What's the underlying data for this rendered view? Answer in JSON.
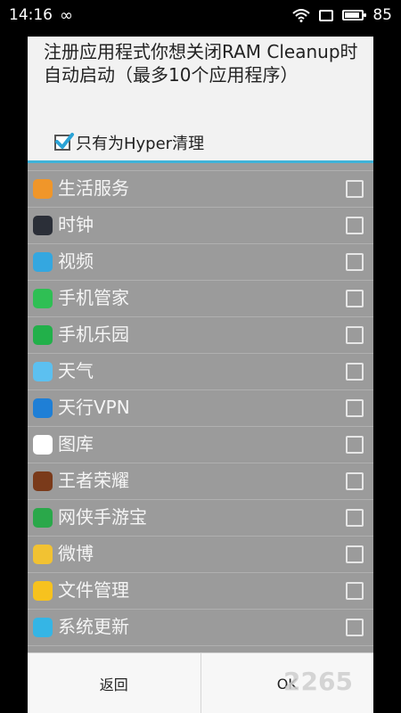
{
  "status_bar": {
    "time": "14:16",
    "battery": "85"
  },
  "dialog": {
    "title": "注册应用程式你想关闭RAM Cleanup时自动启动（最多10个应用程序）",
    "hyper_only_label": "只有为Hyper清理",
    "hyper_only_checked": true
  },
  "apps": [
    {
      "label": "",
      "icon": "partial-icon",
      "color": "#7c7c7c"
    },
    {
      "label": "生活服务",
      "icon": "coffee-cup-icon",
      "color": "#f0962a"
    },
    {
      "label": "时钟",
      "icon": "clock-icon",
      "color": "#2b2f38"
    },
    {
      "label": "视频",
      "icon": "video-clapper-icon",
      "color": "#34a7e0"
    },
    {
      "label": "手机管家",
      "icon": "shield-plus-icon",
      "color": "#2fbf54"
    },
    {
      "label": "手机乐园",
      "icon": "s-store-icon",
      "color": "#22b04a"
    },
    {
      "label": "天气",
      "icon": "cloud-sun-icon",
      "color": "#5cc0f0"
    },
    {
      "label": "天行VPN",
      "icon": "globe-icon",
      "color": "#1f7fd6"
    },
    {
      "label": "图库",
      "icon": "flower-icon",
      "color": "#ffffff"
    },
    {
      "label": "王者荣耀",
      "icon": "hero-game-icon",
      "color": "#7a3a1a"
    },
    {
      "label": "网侠手游宝",
      "icon": "recycle-icon",
      "color": "#2aa84a"
    },
    {
      "label": "微博",
      "icon": "weibo-icon",
      "color": "#f2c232"
    },
    {
      "label": "文件管理",
      "icon": "folder-icon",
      "color": "#f7c21e"
    },
    {
      "label": "系统更新",
      "icon": "arrow-up-icon",
      "color": "#35b5e5"
    }
  ],
  "buttons": {
    "back": "返回",
    "ok": "OK"
  },
  "watermark": "2265"
}
